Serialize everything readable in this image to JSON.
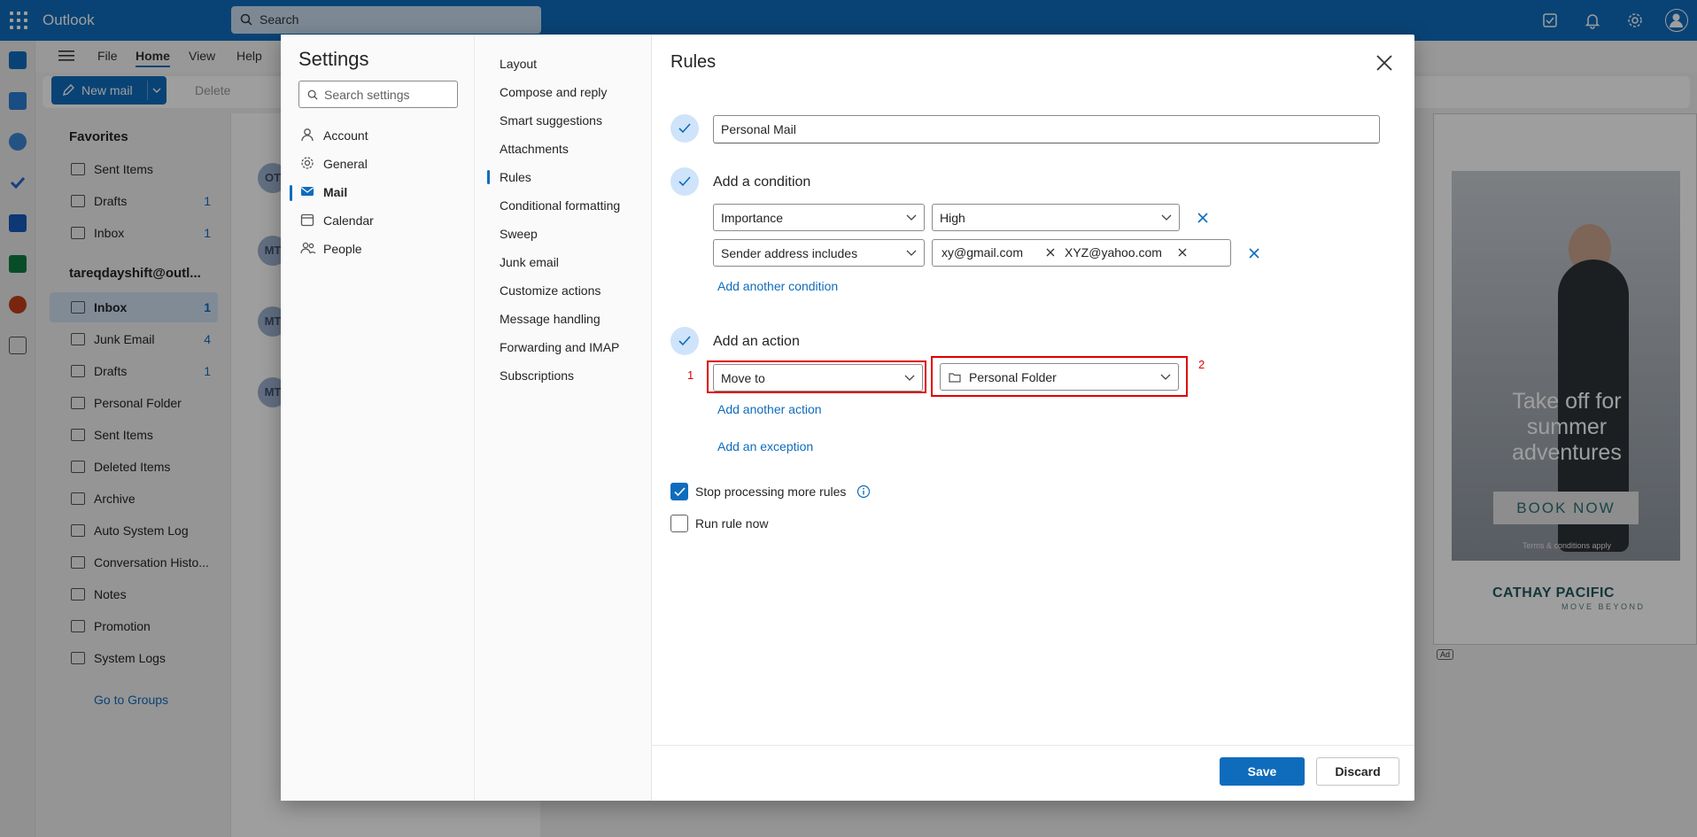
{
  "app": {
    "name": "Outlook"
  },
  "top_search": {
    "placeholder": "Search"
  },
  "ribbon": {
    "tabs": [
      "File",
      "Home",
      "View",
      "Help"
    ],
    "new_mail_label": "New mail",
    "delete_label": "Delete"
  },
  "folders": {
    "favorites_label": "Favorites",
    "favorites": [
      {
        "label": "Sent Items",
        "count": ""
      },
      {
        "label": "Drafts",
        "count": "1"
      },
      {
        "label": "Inbox",
        "count": "1"
      }
    ],
    "account_label": "tareqdayshift@outl...",
    "account_folders": [
      {
        "label": "Inbox",
        "count": "1"
      },
      {
        "label": "Junk Email",
        "count": "4"
      },
      {
        "label": "Drafts",
        "count": "1"
      },
      {
        "label": "Personal Folder",
        "count": ""
      },
      {
        "label": "Sent Items",
        "count": ""
      },
      {
        "label": "Deleted Items",
        "count": ""
      },
      {
        "label": "Archive",
        "count": ""
      },
      {
        "label": "Auto System Log",
        "count": ""
      },
      {
        "label": "Conversation Histo...",
        "count": ""
      },
      {
        "label": "Notes",
        "count": ""
      },
      {
        "label": "Promotion",
        "count": ""
      },
      {
        "label": "System Logs",
        "count": ""
      }
    ],
    "go_to_groups": "Go to Groups"
  },
  "message_list": {
    "avatars": [
      "OT",
      "MT",
      "MT",
      "MT"
    ]
  },
  "ad": {
    "headline": "Take off for summer adventures",
    "button": "BOOK NOW",
    "terms": "Terms & conditions apply",
    "brand": "CATHAY PACIFIC",
    "tagline": "MOVE BEYOND",
    "chip": "Ad"
  },
  "settings": {
    "title": "Settings",
    "search_placeholder": "Search settings",
    "categories": [
      {
        "label": "Account",
        "icon": "person-icon"
      },
      {
        "label": "General",
        "icon": "gear-icon"
      },
      {
        "label": "Mail",
        "icon": "mail-icon",
        "selected": true
      },
      {
        "label": "Calendar",
        "icon": "calendar-icon"
      },
      {
        "label": "People",
        "icon": "people-icon"
      }
    ],
    "mail_sections": [
      "Layout",
      "Compose and reply",
      "Smart suggestions",
      "Attachments",
      "Rules",
      "Conditional formatting",
      "Sweep",
      "Junk email",
      "Customize actions",
      "Message handling",
      "Forwarding and IMAP",
      "Subscriptions"
    ],
    "selected_section": "Rules"
  },
  "rules": {
    "title": "Rules",
    "rule_name": "Personal Mail",
    "condition_heading": "Add a condition",
    "conditions": [
      {
        "field": "Importance",
        "value": "High"
      },
      {
        "field": "Sender address includes",
        "chips": [
          "xy@gmail.com",
          "XYZ@yahoo.com"
        ]
      }
    ],
    "add_condition_link": "Add another condition",
    "action_heading": "Add an action",
    "action": {
      "type": "Move to",
      "folder": "Personal Folder"
    },
    "add_action_link": "Add another action",
    "add_exception_link": "Add an exception",
    "stop_processing_label": "Stop processing more rules",
    "stop_processing_checked": true,
    "run_now_label": "Run rule now",
    "run_now_checked": false,
    "save_label": "Save",
    "discard_label": "Discard",
    "annotation_1": "1",
    "annotation_2": "2"
  },
  "colors": {
    "accent": "#0f6cbd",
    "highlight": "#e00000"
  }
}
